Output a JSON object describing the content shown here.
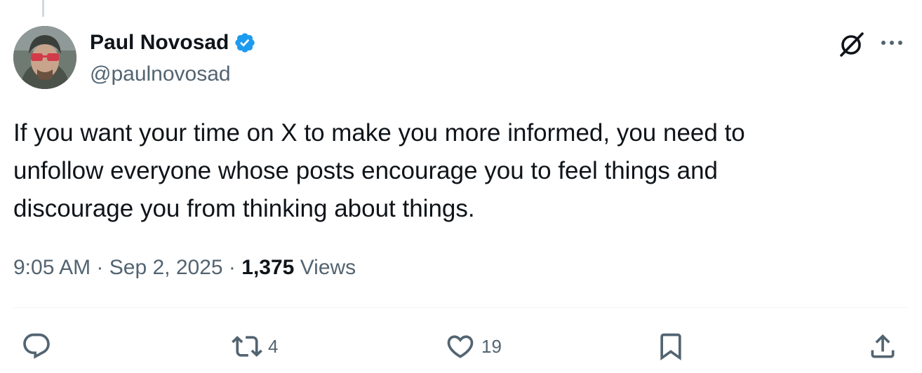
{
  "author": {
    "name": "Paul Novosad",
    "handle": "@paulnovosad",
    "verified": true,
    "verified_color": "#1d9bf0"
  },
  "tweet": {
    "text": "If you want your time on X to make you more informed, you need to\nunfollow everyone whose posts encourage you to feel things and\ndiscourage you from thinking about things.",
    "time": "9:05 AM",
    "date": "Sep 2, 2025",
    "separator": "·",
    "views_count": "1,375",
    "views_label": "Views"
  },
  "actions": {
    "reply_icon": "reply-icon",
    "retweet_icon": "retweet-icon",
    "retweet_count": "4",
    "like_icon": "heart-icon",
    "like_count": "19",
    "bookmark_icon": "bookmark-icon",
    "share_icon": "share-icon"
  },
  "header_icons": [
    "grok-icon",
    "more-icon"
  ],
  "colors": {
    "text_primary": "#0f1419",
    "text_secondary": "#536471",
    "divider": "#eff3f4",
    "thread_line": "#cfd9de"
  }
}
